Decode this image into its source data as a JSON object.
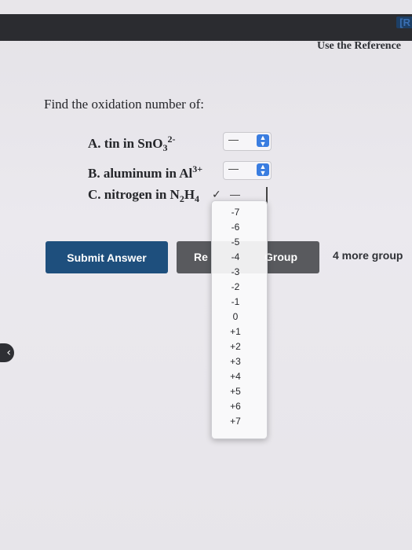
{
  "toolbar": {
    "link": "[R"
  },
  "reference_link": "Use the Reference",
  "prompt": "Find the oxidation number of:",
  "questions": {
    "a": {
      "label": "A. tin in SnO",
      "sub": "3",
      "sup": "2-",
      "selected": "—"
    },
    "b": {
      "label": "B. aluminum in Al",
      "sup": "3+",
      "selected": "—"
    },
    "c": {
      "label": "C. nitrogen in N",
      "sub1": "2",
      "mid": "H",
      "sub2": "4",
      "check": "✓",
      "selected": "—"
    }
  },
  "dropdown": {
    "options": [
      "-7",
      "-6",
      "-5",
      "-4",
      "-3",
      "-2",
      "-1",
      "0",
      "+1",
      "+2",
      "+3",
      "+4",
      "+5",
      "+6",
      "+7"
    ]
  },
  "buttons": {
    "submit": "Submit Answer",
    "retry_left": "Re",
    "retry_right": "Group",
    "more_groups": "4 more group"
  },
  "back_icon": "‹",
  "colors": {
    "submit_bg": "#1e4f7d",
    "retry_bg": "#595a5e",
    "select_arrow": "#3a7de0"
  }
}
